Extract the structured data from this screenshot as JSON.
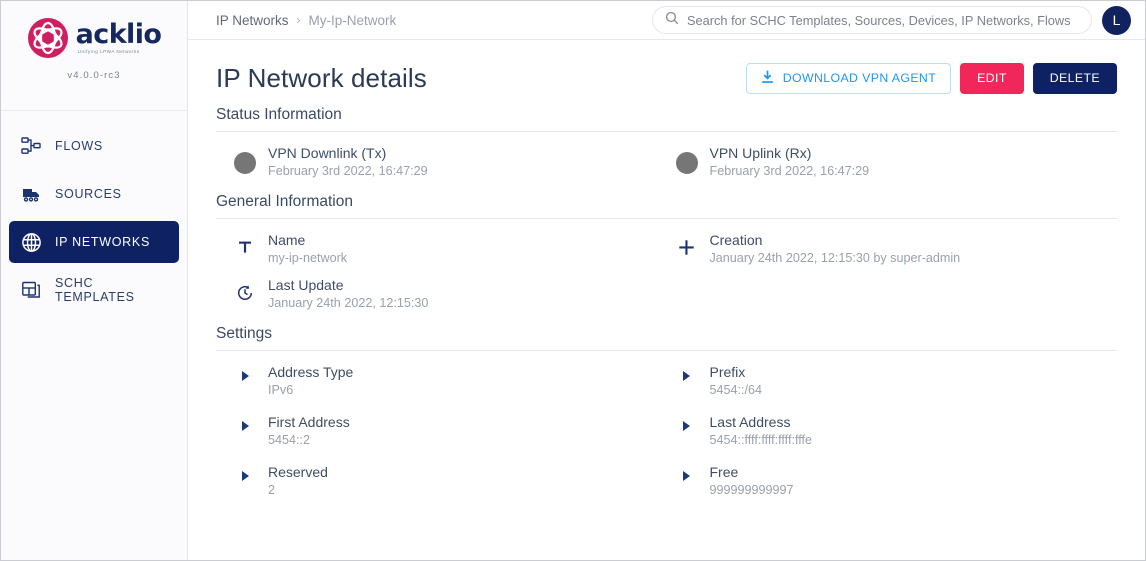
{
  "sidebar": {
    "brand": {
      "name": "acklio",
      "tagline": "Unifying LPWA Networks",
      "version": "v4.0.0-rc3"
    },
    "items": [
      {
        "label": "FLOWS",
        "icon": "flows-icon",
        "active": false
      },
      {
        "label": "SOURCES",
        "icon": "sources-icon",
        "active": false
      },
      {
        "label": "IP NETWORKS",
        "icon": "globe-icon",
        "active": true
      },
      {
        "label": "SCHC TEMPLATES",
        "icon": "schc-templates-icon",
        "active": false
      }
    ]
  },
  "topbar": {
    "breadcrumb": {
      "parent": "IP Networks",
      "separator": "›",
      "current": "My-Ip-Network"
    },
    "search": {
      "placeholder": "Search for SCHC Templates, Sources, Devices, IP Networks, Flows",
      "value": ""
    },
    "avatar": {
      "initial": "L"
    }
  },
  "page": {
    "title": "IP Network details",
    "actions": {
      "download": "DOWNLOAD VPN AGENT",
      "edit": "EDIT",
      "delete": "DELETE"
    }
  },
  "status_section": {
    "title": "Status Information",
    "items": [
      {
        "label": "VPN Downlink (Tx)",
        "value": "February 3rd 2022, 16:47:29",
        "dot_color": "#767676"
      },
      {
        "label": "VPN Uplink (Rx)",
        "value": "February 3rd 2022, 16:47:29",
        "dot_color": "#767676"
      }
    ]
  },
  "general_section": {
    "title": "General Information",
    "items": [
      {
        "label": "Name",
        "value": "my-ip-network",
        "icon": "text-t-icon"
      },
      {
        "label": "Creation",
        "value": "January 24th 2022, 12:15:30 by super-admin",
        "icon": "plus-icon"
      },
      {
        "label": "Last Update",
        "value": "January 24th 2022, 12:15:30",
        "icon": "history-clock-icon"
      }
    ]
  },
  "settings_section": {
    "title": "Settings",
    "items": [
      {
        "label": "Address Type",
        "value": "IPv6"
      },
      {
        "label": "Prefix",
        "value": "5454::/64"
      },
      {
        "label": "First Address",
        "value": "5454::2"
      },
      {
        "label": "Last Address",
        "value": "5454::ffff:ffff:ffff:fffe"
      },
      {
        "label": "Reserved",
        "value": "2"
      },
      {
        "label": "Free",
        "value": "999999999997"
      }
    ]
  },
  "colors": {
    "navy": "#0d2163",
    "pink": "#f1275b",
    "link_blue": "#2196f3",
    "logo_magenta": "#cf1f63"
  }
}
